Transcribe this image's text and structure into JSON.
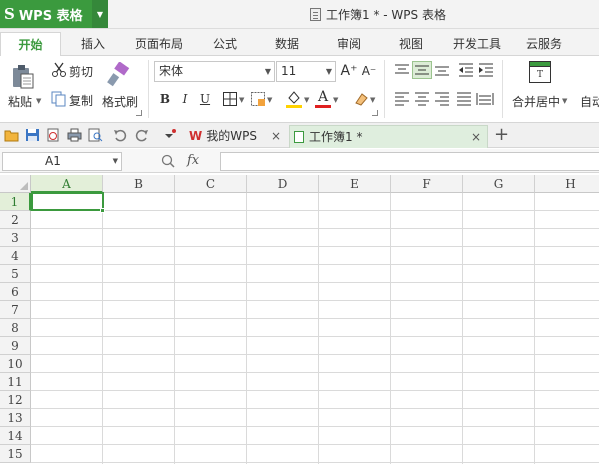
{
  "app": {
    "name": "WPS 表格",
    "logo_glyph": "S",
    "brand_color": "#3b9a3e",
    "window_title": "工作簿1 * - WPS 表格"
  },
  "tabs": [
    "开始",
    "插入",
    "页面布局",
    "公式",
    "数据",
    "审阅",
    "视图",
    "开发工具",
    "云服务"
  ],
  "active_tab": "开始",
  "ribbon": {
    "paste_label": "粘贴",
    "cut_label": "剪切",
    "copy_label": "复制",
    "format_painter_label": "格式刷",
    "font_name": "宋体",
    "font_size": "11",
    "bold_glyph": "B",
    "italic_glyph": "I",
    "underline_glyph": "U",
    "font_color_glyph": "A",
    "grow_font_glyph": "A⁺",
    "shrink_font_glyph": "A⁻",
    "merge_center_label": "合并居中",
    "autowrap_label": "自动"
  },
  "doc_tabs": [
    {
      "label": "我的WPS"
    },
    {
      "label": "工作簿1 *"
    }
  ],
  "add_tab_glyph": "+",
  "close_glyph": "×",
  "formula_bar": {
    "name_box": "A1",
    "fx_label": "fx",
    "formula": ""
  },
  "sheet": {
    "columns": [
      "A",
      "B",
      "C",
      "D",
      "E",
      "F",
      "G",
      "H"
    ],
    "rows": [
      "1",
      "2",
      "3",
      "4",
      "5",
      "6",
      "7",
      "8",
      "9",
      "10",
      "11",
      "12",
      "13",
      "14",
      "15"
    ],
    "selected_cell": "A1"
  }
}
